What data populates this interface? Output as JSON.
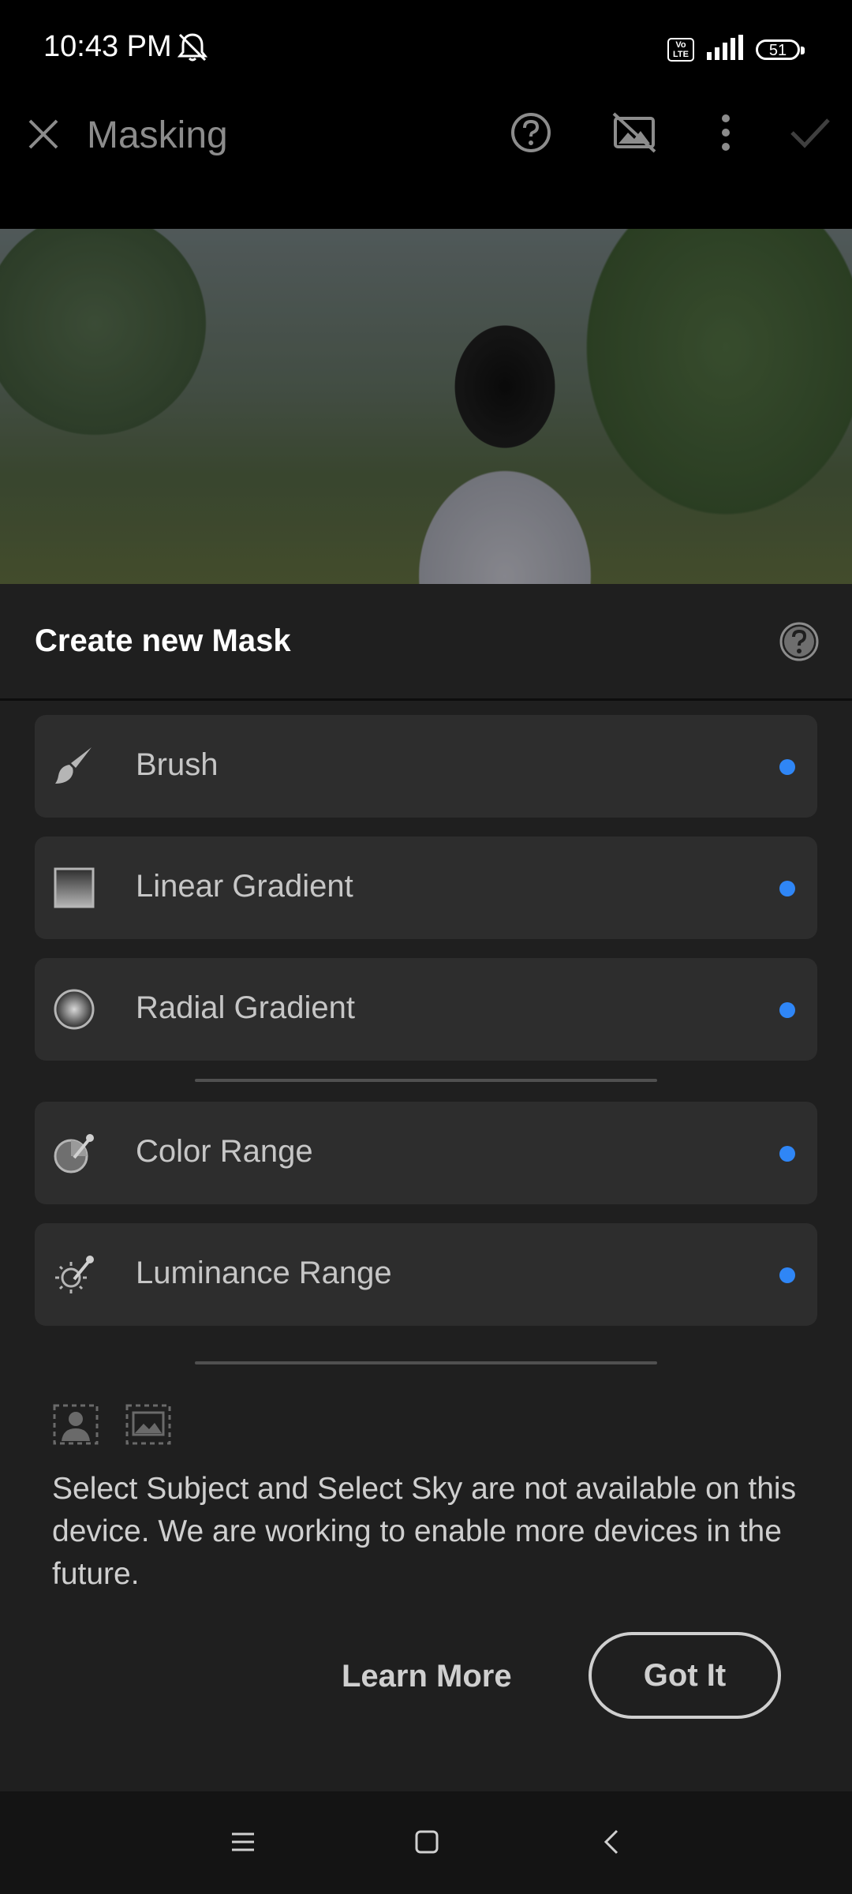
{
  "status_bar": {
    "time": "10:43 PM",
    "bell_icon": "bell-off-icon",
    "volte": "Vo LTE",
    "battery": "51"
  },
  "top_bar": {
    "title": "Masking",
    "icons": [
      "close-icon",
      "help-icon",
      "mask-overlay-off-icon",
      "more-vert-icon",
      "checkmark-icon"
    ]
  },
  "sheet": {
    "title": "Create new Mask",
    "items": [
      {
        "label": "Brush",
        "icon": "brush-icon"
      },
      {
        "label": "Linear Gradient",
        "icon": "linear-gradient-icon"
      },
      {
        "label": "Radial Gradient",
        "icon": "radial-gradient-icon"
      },
      {
        "label": "Color Range",
        "icon": "color-range-icon"
      },
      {
        "label": "Luminance Range",
        "icon": "luminance-range-icon"
      }
    ],
    "dot_color": "#2f86f6",
    "info_text": "Select Subject and Select Sky are not available on this device. We are working to enable more devices in the future.",
    "learn_more": "Learn More",
    "got_it": "Got It"
  },
  "nav_bar": {
    "icons": [
      "menu-icon",
      "home-icon",
      "back-icon"
    ]
  }
}
